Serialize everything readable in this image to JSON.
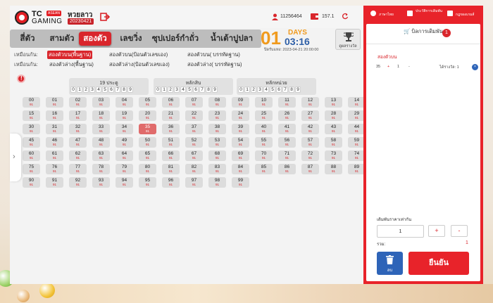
{
  "header": {
    "logo_tc": "TC",
    "logo_asean": "ASEAN",
    "logo_gaming": "GAMING",
    "lottery_name": "หวยลาว",
    "lottery_date": "20230421",
    "user_id": "11256464",
    "balance": "157.1"
  },
  "tabs": [
    {
      "label": "สี่ตัว"
    },
    {
      "label": "สามตัว"
    },
    {
      "label": "สองตัว"
    },
    {
      "label": "เลขวิ่ง"
    },
    {
      "label": "ซุปเปอร์กำถั่ว"
    },
    {
      "label": "น้ำเต้าปูปลา"
    }
  ],
  "countdown": {
    "days": "01",
    "days_label": "DAYS",
    "time": "03:16",
    "close_time": "ปิดรับแทง: 2023-04-21 20:00:00"
  },
  "rewards": {
    "label": "ดูผลรางวัล"
  },
  "options": {
    "row1_lead": "เหมือนกัน:",
    "row1": [
      "สองตัวบน(พื้นฐาน)",
      "สองตัวบน(ป้อนตัวเลขเอง)",
      "สองตัวบน( บรรทัดฐาน)"
    ],
    "row2_lead": "เหมือนกัน:",
    "row2": [
      "สองตัวล่าง(พื้นฐาน)",
      "สองตัวล่าง(ป้อนตัวเลขเอง)",
      "สองตัวล่าง( บรรทัดฐาน)"
    ]
  },
  "digit_groups": [
    {
      "title": "19 ประตู",
      "digits": [
        "0",
        "1",
        "2",
        "3",
        "4",
        "5",
        "6",
        "7",
        "8",
        "9"
      ]
    },
    {
      "title": "หลักสิบ",
      "digits": [
        "0",
        "1",
        "2",
        "3",
        "4",
        "5",
        "6",
        "7",
        "8",
        "9"
      ]
    },
    {
      "title": "หลักหน่วย",
      "digits": [
        "0",
        "1",
        "2",
        "3",
        "4",
        "5",
        "6",
        "7",
        "8",
        "9"
      ]
    }
  ],
  "grid": {
    "payout": "91",
    "selected": "35"
  },
  "panel": {
    "language": "ภาษาไทย",
    "history": "ประวัติการเดิมพัน",
    "rules": "กฎของเกมส์",
    "bet_title": "บิลการเดิมพัน",
    "bet_count": "1",
    "bet_type": "สองตัวบน",
    "bet_number": "35",
    "bet_amount": "1",
    "bet_payout": "ได้รางวัล: 1",
    "qty_label": "เดิมพันราคาเท่ากัน",
    "qty_value": "1",
    "plus": "+",
    "minus": "-",
    "total_label": "รวม:",
    "total_value": "1",
    "delete": "ลบ",
    "confirm": "ยืนยัน"
  },
  "colors": {
    "accent_red": "#e8232a",
    "tab_active": "#d9262c",
    "countdown_orange": "#f09a1d",
    "time_blue": "#2e5fa7",
    "delete_blue": "#2e64b8"
  },
  "icons": [
    "exit-icon",
    "user-icon",
    "wallet-icon",
    "refresh-icon",
    "trophy-icon",
    "globe-icon",
    "document-icon",
    "book-icon",
    "cart-icon",
    "trash-icon",
    "chevron-left-icon",
    "info-icon"
  ]
}
